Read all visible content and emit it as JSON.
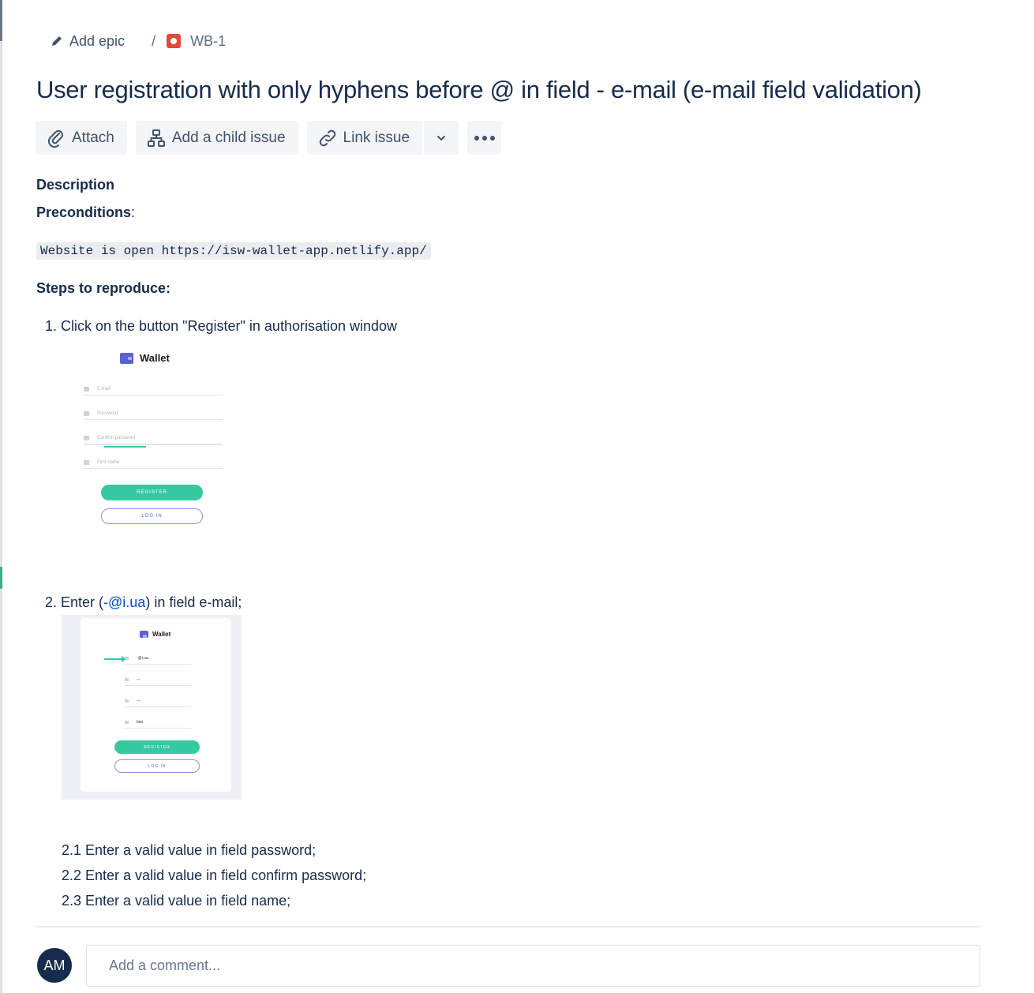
{
  "breadcrumb": {
    "add_epic": "Add epic",
    "separator": "/",
    "issue_key": "WB-1"
  },
  "issue": {
    "title": "User registration with only hyphens before @ in field - e-mail (e-mail field validation)"
  },
  "toolbar": {
    "attach": "Attach",
    "add_child": "Add a child issue",
    "link_issue": "Link issue",
    "icons": [
      "paperclip-icon",
      "hierarchy-icon",
      "link-icon",
      "chevron-down-icon",
      "more-icon"
    ]
  },
  "description": {
    "heading": "Description",
    "preconditions_label": "Preconditions",
    "preconditions_colon": ":",
    "code": "Website is open https://isw-wallet-app.netlify.app/",
    "steps_heading": "Steps to reproduce:",
    "step1": "1. Click on the button \"Register\" in authorisation window",
    "step2_prefix": "2.   Enter (",
    "step2_link": "-@i.ua",
    "step2_suffix": ") in  field e-mail;",
    "sub_steps": [
      "2.1  Enter a valid value in field password;",
      "2.2  Enter a valid value in field confirm password;",
      "2.3 Enter a valid value in  field name;"
    ]
  },
  "screenshot1": {
    "logo": "Wallet",
    "fields": [
      "E-mail",
      "Password",
      "Confirm password",
      "First name"
    ],
    "register": "REGISTER",
    "login": "LOG IN"
  },
  "screenshot2": {
    "logo": "Wallet",
    "fields": [
      "-@i.ua",
      "---",
      "---",
      "ben"
    ],
    "register": "REGISTER",
    "login": "LOG IN"
  },
  "comment": {
    "avatar_initials": "AM",
    "placeholder": "Add a comment..."
  },
  "colors": {
    "accent": "#0052cc",
    "register_green": "#35c9a0",
    "bug_red": "#e5493a",
    "avatar_bg": "#172b4d"
  }
}
